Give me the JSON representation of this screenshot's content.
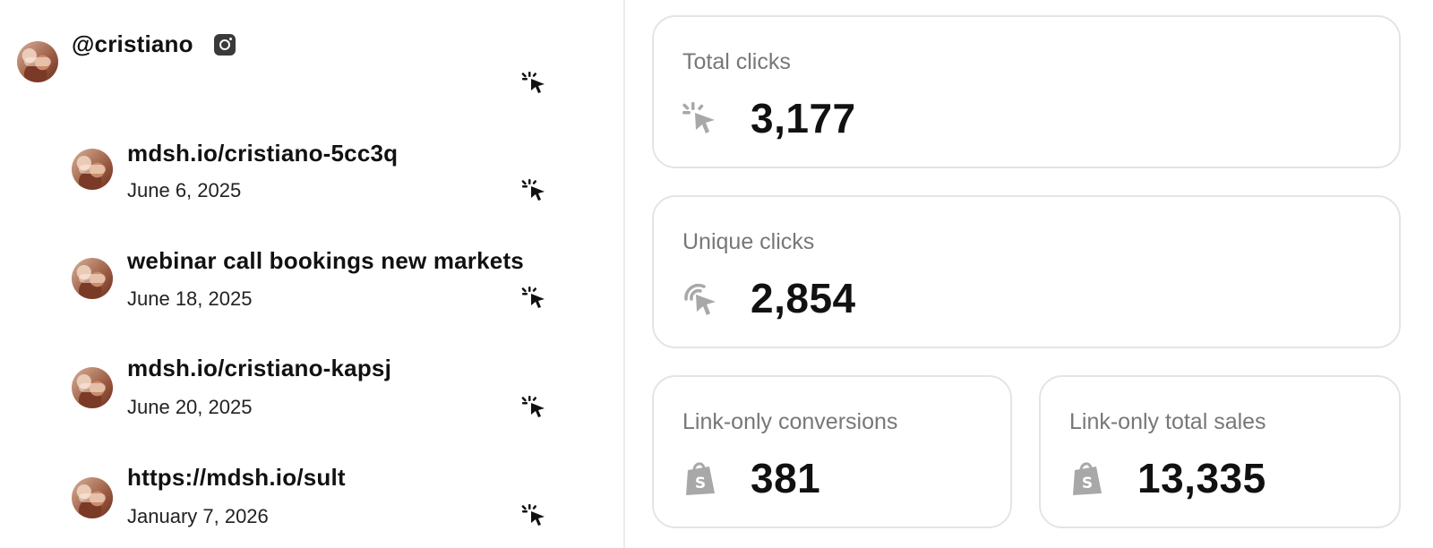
{
  "profile": {
    "handle": "@cristiano",
    "platform_icon": "instagram-icon"
  },
  "links": [
    {
      "title": "mdsh.io/cristiano-5cc3q",
      "date": "June 6, 2025"
    },
    {
      "title": "webinar call bookings new markets",
      "date": "June 18, 2025"
    },
    {
      "title": "mdsh.io/cristiano-kapsj",
      "date": "June 20, 2025"
    },
    {
      "title": "https://mdsh.io/sult",
      "date": "January 7, 2026"
    }
  ],
  "stats": {
    "total_clicks": {
      "label": "Total clicks",
      "value": "3,177",
      "icon": "click-icon"
    },
    "unique_clicks": {
      "label": "Unique clicks",
      "value": "2,854",
      "icon": "unique-click-icon"
    },
    "conversions": {
      "label": "Link-only conversions",
      "value": "381",
      "icon": "shopify-bag-icon"
    },
    "total_sales": {
      "label": "Link-only total sales",
      "value": "13,335",
      "icon": "shopify-bag-icon"
    }
  },
  "colors": {
    "icon_dark": "#111111",
    "icon_muted": "#a8a8a8",
    "card_border": "#e4e4e4",
    "label_gray": "#777777"
  }
}
